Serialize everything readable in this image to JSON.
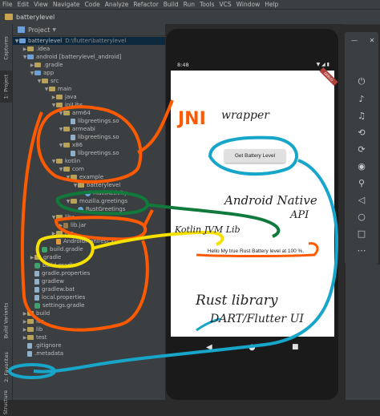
{
  "menu": {
    "items": [
      "File",
      "Edit",
      "View",
      "Navigate",
      "Code",
      "Analyze",
      "Refactor",
      "Build",
      "Run",
      "Tools",
      "VCS",
      "Window",
      "Help"
    ]
  },
  "navbar": {
    "title": "batterylevel"
  },
  "side_tabs": {
    "captures": "Captures",
    "project": "1: Project",
    "build_variants": "Build Variants",
    "favorites": "2: Favorites",
    "structure": "Structure"
  },
  "project_panel": {
    "header": "Project",
    "root_name": "batterylevel",
    "root_path": "D:\\flutter\\batterylevel",
    "tree": [
      {
        "label": ".idea",
        "indent": 2,
        "arrow": "▶",
        "icon": "dir"
      },
      {
        "label": "android [batterylevel_android]",
        "indent": 2,
        "arrow": "▼",
        "icon": "mod"
      },
      {
        "label": ".gradle",
        "indent": 3,
        "arrow": "▶",
        "icon": "dir"
      },
      {
        "label": "app",
        "indent": 3,
        "arrow": "▼",
        "icon": "mod"
      },
      {
        "label": "src",
        "indent": 4,
        "arrow": "▼",
        "icon": "dir"
      },
      {
        "label": "main",
        "indent": 5,
        "arrow": "▼",
        "icon": "dir"
      },
      {
        "label": "java",
        "indent": 6,
        "arrow": "▶",
        "icon": "dir"
      },
      {
        "label": "jniLibs",
        "indent": 6,
        "arrow": "▼",
        "icon": "dir"
      },
      {
        "label": "arm64",
        "indent": 7,
        "arrow": "▼",
        "icon": "dir"
      },
      {
        "label": "libgreetings.so",
        "indent": 8,
        "arrow": "",
        "icon": "file"
      },
      {
        "label": "armeabi",
        "indent": 7,
        "arrow": "▼",
        "icon": "dir"
      },
      {
        "label": "libgreetings.so",
        "indent": 8,
        "arrow": "",
        "icon": "file"
      },
      {
        "label": "x86",
        "indent": 7,
        "arrow": "▼",
        "icon": "dir"
      },
      {
        "label": "libgreetings.so",
        "indent": 8,
        "arrow": "",
        "icon": "file"
      },
      {
        "label": "kotlin",
        "indent": 6,
        "arrow": "▼",
        "icon": "dir"
      },
      {
        "label": "com",
        "indent": 7,
        "arrow": "▼",
        "icon": "dir"
      },
      {
        "label": "example",
        "indent": 8,
        "arrow": "▼",
        "icon": "dir"
      },
      {
        "label": "batterylevel",
        "indent": 9,
        "arrow": "▼",
        "icon": "dir"
      },
      {
        "label": "MainActivity",
        "indent": 10,
        "arrow": "",
        "icon": "kt"
      },
      {
        "label": "mozilla.greetings",
        "indent": 8,
        "arrow": "▼",
        "icon": "dir"
      },
      {
        "label": "RustGreetings",
        "indent": 9,
        "arrow": "",
        "icon": "kt"
      },
      {
        "label": "libs",
        "indent": 6,
        "arrow": "▼",
        "icon": "dir"
      },
      {
        "label": "lib.jar",
        "indent": 7,
        "arrow": "▶",
        "icon": "jar"
      },
      {
        "label": "res",
        "indent": 6,
        "arrow": "▶",
        "icon": "dir"
      },
      {
        "label": "AndroidManifest.xml",
        "indent": 6,
        "arrow": "",
        "icon": "xml"
      },
      {
        "label": "build.gradle",
        "indent": 4,
        "arrow": "",
        "icon": "gr"
      },
      {
        "label": "gradle",
        "indent": 3,
        "arrow": "▶",
        "icon": "dir"
      },
      {
        "label": "build.gradle",
        "indent": 3,
        "arrow": "",
        "icon": "gr"
      },
      {
        "label": "gradle.properties",
        "indent": 3,
        "arrow": "",
        "icon": "file"
      },
      {
        "label": "gradlew",
        "indent": 3,
        "arrow": "",
        "icon": "file"
      },
      {
        "label": "gradlew.bat",
        "indent": 3,
        "arrow": "",
        "icon": "file"
      },
      {
        "label": "local.properties",
        "indent": 3,
        "arrow": "",
        "icon": "file"
      },
      {
        "label": "settings.gradle",
        "indent": 3,
        "arrow": "",
        "icon": "gr"
      },
      {
        "label": "build",
        "indent": 2,
        "arrow": "▶",
        "icon": "dir"
      },
      {
        "label": "ios",
        "indent": 2,
        "arrow": "▶",
        "icon": "dir"
      },
      {
        "label": "lib",
        "indent": 2,
        "arrow": "▶",
        "icon": "dir"
      },
      {
        "label": "test",
        "indent": 2,
        "arrow": "▶",
        "icon": "dir"
      },
      {
        "label": ".gitignore",
        "indent": 2,
        "arrow": "",
        "icon": "file"
      },
      {
        "label": ".metadata",
        "indent": 2,
        "arrow": "",
        "icon": "file"
      }
    ]
  },
  "device": {
    "time": "8:48",
    "status_icons": "▼ ◢ ▮",
    "debug_banner": "DEBUG",
    "button_label": "Get Battery Level",
    "message": "Hello My true Rust Battery level at 100 %.",
    "nav_back": "◀",
    "nav_home": "●",
    "nav_recent": "■"
  },
  "emulator_toolbar": [
    "close-icon",
    "minimize-icon",
    "power-icon",
    "volume-up-icon",
    "volume-down-icon",
    "rotate-left-icon",
    "rotate-right-icon",
    "camera-icon",
    "zoom-icon",
    "back-icon",
    "home-icon",
    "overview-icon",
    "more-icon"
  ],
  "annotations": {
    "jni": "JNI",
    "wrapper": "wrapper",
    "android_native": "Android Native",
    "api": "API",
    "kotlin_jvm": "Kotlin JVM Lib",
    "rust_library": "Rust library",
    "dart_flutter": "DART/Flutter UI"
  },
  "colors": {
    "orange": "#ff5a00",
    "green": "#0f7a3c",
    "yellow": "#f5e000",
    "cyan": "#17a6c9"
  }
}
